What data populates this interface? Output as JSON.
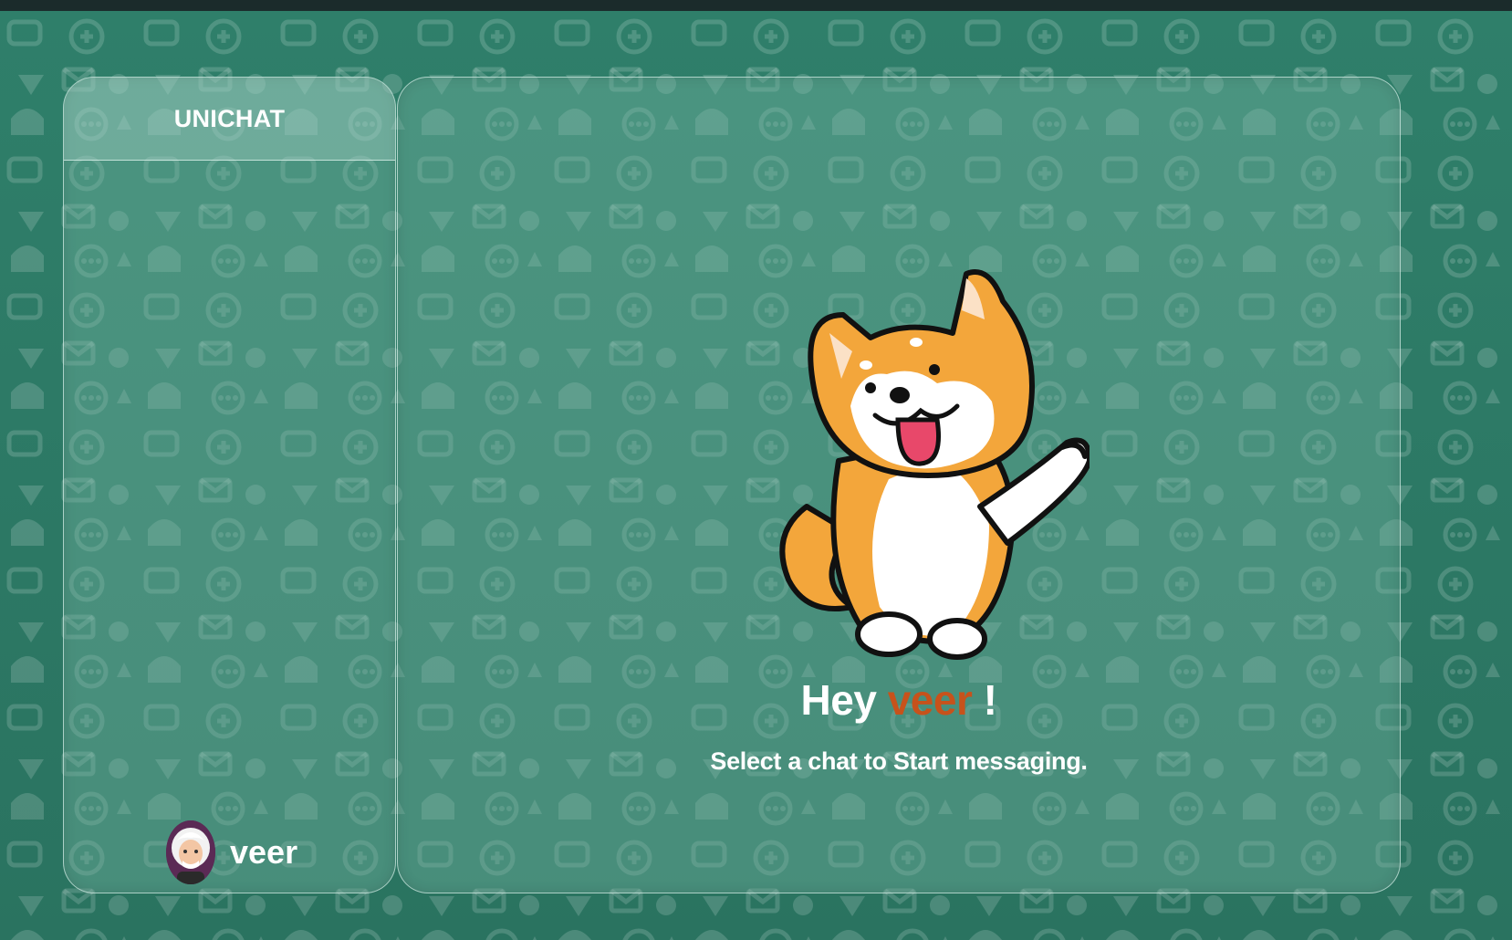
{
  "app": {
    "title": "UNICHAT"
  },
  "sidebar": {
    "chats": [],
    "current_user": {
      "name": "veer",
      "avatar": "user-avatar"
    }
  },
  "main": {
    "greeting_prefix": "Hey",
    "greeting_name": "veer",
    "greeting_suffix": "!",
    "subtitle": "Select a chat to Start messaging.",
    "illustration": "shiba-inu-waving"
  },
  "colors": {
    "background": "#2e7a66",
    "accent_username": "#c7521b",
    "panel_border": "#e1f5ee",
    "text": "#ffffff"
  }
}
